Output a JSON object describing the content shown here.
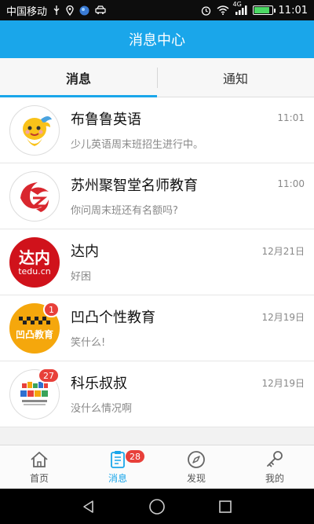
{
  "status_bar": {
    "carrier": "中国移动",
    "network": "4G",
    "time": "11:01"
  },
  "header": {
    "title": "消息中心"
  },
  "tabs": [
    {
      "label": "消息",
      "active": true
    },
    {
      "label": "通知",
      "active": false
    }
  ],
  "conversations": [
    {
      "name": "布鲁鲁英语",
      "preview": "少儿英语周末班招生进行中。",
      "time": "11:01",
      "badge": "",
      "avatar_icon": "cartoon-mascot-icon"
    },
    {
      "name": "苏州聚智堂名师教育",
      "preview": "你问周末班还有名额吗?",
      "time": "11:00",
      "badge": "",
      "avatar_icon": "juzhitang-logo-icon"
    },
    {
      "name": "达内",
      "preview": "好困",
      "time": "12月21日",
      "badge": "",
      "avatar_icon": "tedu-logo-icon",
      "avatar_text": "达内",
      "avatar_subtext": "tedu.cn"
    },
    {
      "name": "凹凸个性教育",
      "preview": "笑什么!",
      "time": "12月19日",
      "badge": "1",
      "avatar_icon": "aotu-logo-icon",
      "avatar_text": "凹凸教育"
    },
    {
      "name": "科乐叔叔",
      "preview": "没什么情况啊",
      "time": "12月19日",
      "badge": "27",
      "avatar_icon": "kele-logo-icon"
    }
  ],
  "bottom_nav": [
    {
      "label": "首页",
      "icon": "home-icon",
      "active": false,
      "badge": ""
    },
    {
      "label": "消息",
      "icon": "message-icon",
      "active": true,
      "badge": "28"
    },
    {
      "label": "发现",
      "icon": "compass-icon",
      "active": false,
      "badge": ""
    },
    {
      "label": "我的",
      "icon": "key-icon",
      "active": false,
      "badge": ""
    }
  ],
  "colors": {
    "accent": "#1aa6ea",
    "badge": "#e8403a",
    "tedu_red": "#d0121b",
    "aotu_yellow": "#f5a70c"
  },
  "status_bar_battery_level": 0.8
}
